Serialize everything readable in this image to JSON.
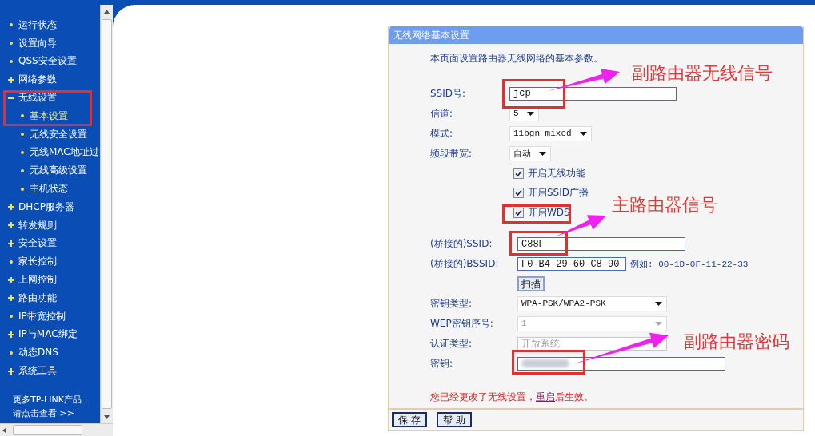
{
  "sidebar": {
    "items": [
      {
        "kind": "leaf",
        "label": "运行状态",
        "selected": false
      },
      {
        "kind": "leaf",
        "label": "设置向导",
        "selected": false
      },
      {
        "kind": "leaf",
        "label": "QSS安全设置",
        "selected": false
      },
      {
        "kind": "group",
        "label": "网络参数",
        "selected": false,
        "expanded": false
      },
      {
        "kind": "group",
        "label": "无线设置",
        "selected": false,
        "expanded": true,
        "children": [
          {
            "kind": "leaf",
            "label": "基本设置",
            "selected": true
          },
          {
            "kind": "leaf",
            "label": "无线安全设置",
            "selected": false
          },
          {
            "kind": "leaf",
            "label": "无线MAC地址过",
            "selected": false
          },
          {
            "kind": "leaf",
            "label": "无线高级设置",
            "selected": false
          },
          {
            "kind": "leaf",
            "label": "主机状态",
            "selected": false
          }
        ]
      },
      {
        "kind": "group",
        "label": "DHCP服务器",
        "selected": false,
        "expanded": false
      },
      {
        "kind": "group",
        "label": "转发规则",
        "selected": false,
        "expanded": false
      },
      {
        "kind": "group",
        "label": "安全设置",
        "selected": false,
        "expanded": false
      },
      {
        "kind": "leaf",
        "label": "家长控制",
        "selected": false
      },
      {
        "kind": "group",
        "label": "上网控制",
        "selected": false,
        "expanded": false
      },
      {
        "kind": "group",
        "label": "路由功能",
        "selected": false,
        "expanded": false
      },
      {
        "kind": "leaf",
        "label": "IP带宽控制",
        "selected": false
      },
      {
        "kind": "group",
        "label": "IP与MAC绑定",
        "selected": false,
        "expanded": false
      },
      {
        "kind": "leaf",
        "label": "动态DNS",
        "selected": false
      },
      {
        "kind": "group",
        "label": "系统工具",
        "selected": false,
        "expanded": false
      }
    ],
    "footer": [
      "更多TP-LINK产品，",
      "请点击查看 >>"
    ]
  },
  "panel": {
    "title": "无线网络基本设置",
    "intro": "本页面设置路由器无线网络的基本参数。",
    "sections": [
      [
        {
          "kind": "text",
          "label": "SSID号:",
          "value": "jcp"
        },
        {
          "kind": "select",
          "label": "信道:",
          "value": "5"
        },
        {
          "kind": "select",
          "label": "模式:",
          "value": "11bgn mixed"
        },
        {
          "kind": "select",
          "label": "频段带宽:",
          "value": "自动"
        },
        {
          "kind": "checkbox",
          "label": "开启无线功能",
          "checked": true
        },
        {
          "kind": "checkbox",
          "label": "开启SSID广播",
          "checked": true
        },
        {
          "kind": "checkbox",
          "label": "开启WDS",
          "checked": true
        }
      ],
      [
        {
          "kind": "text",
          "label": "(桥接的)SSID:",
          "value": "C88F"
        },
        {
          "kind": "text",
          "label": "(桥接的)BSSID:",
          "value": "F0-B4-29-60-C8-90",
          "hint": "例如: 00-1D-0F-11-22-33"
        },
        {
          "kind": "button",
          "label": "扫描"
        },
        {
          "kind": "select",
          "label": "密钥类型:",
          "value": "WPA-PSK/WPA2-PSK",
          "disabled": false
        },
        {
          "kind": "select",
          "label": "WEP密钥序号:",
          "value": "1",
          "disabled": true
        },
        {
          "kind": "text",
          "label": "认证类型:",
          "value": "开放系统",
          "disabled": true
        },
        {
          "kind": "password",
          "label": "密钥:"
        }
      ]
    ],
    "notice": "您已经更改了无线设置，",
    "notice_link": "重启",
    "notice_end": "后生效。",
    "buttons": [
      "保 存",
      "帮 助"
    ]
  },
  "annotations": [
    "副路由器无线信号",
    "主路由器信号",
    "副路由器密码"
  ]
}
